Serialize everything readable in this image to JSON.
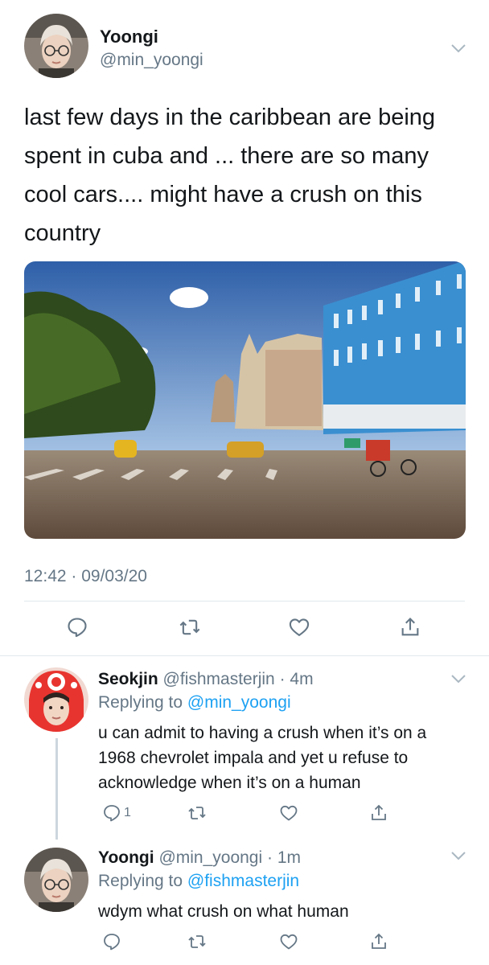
{
  "main_tweet": {
    "display_name": "Yoongi",
    "handle": "@min_yoongi",
    "text": "last few days in the caribbean are being spent in cuba and ... there are so many cool cars.... might have a crush on this country",
    "timestamp": "12:42 · 09/03/20",
    "icons": [
      "reply-icon",
      "retweet-icon",
      "like-icon",
      "share-icon"
    ]
  },
  "replies": [
    {
      "display_name": "Seokjin",
      "handle_time": "@fishmasterjin · 4m",
      "replying_prefix": "Replying to",
      "replying_to": "@min_yoongi",
      "text": "u can admit to having a crush when it’s on a 1968 chevrolet impala and yet u refuse to acknowledge when it’s on a human",
      "reply_count": "1"
    },
    {
      "display_name": "Yoongi",
      "handle_time": "@min_yoongi · 1m",
      "replying_prefix": "Replying to",
      "replying_to": "@fishmasterjin",
      "text": "wdym what crush on what human",
      "reply_count": ""
    }
  ],
  "colors": {
    "text": "#14171a",
    "secondary": "#657786",
    "link": "#1da1f2",
    "divider": "#e1e8ed"
  }
}
